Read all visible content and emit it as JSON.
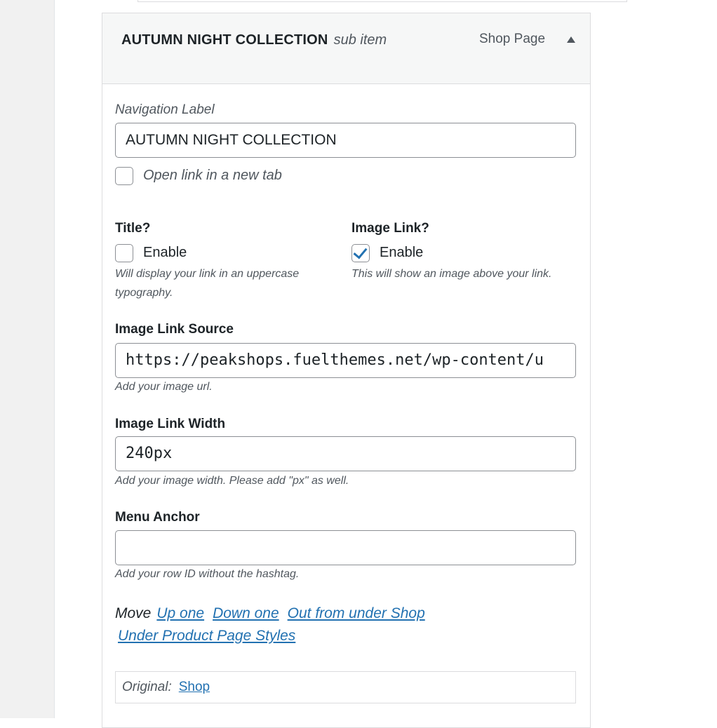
{
  "item": {
    "title": "AUTUMN NIGHT COLLECTION",
    "subtitle": "sub item",
    "type": "Shop Page"
  },
  "fields": {
    "nav_label": {
      "label": "Navigation Label",
      "value": "AUTUMN NIGHT COLLECTION"
    },
    "new_tab": {
      "label": "Open link in a new tab",
      "checked": false
    },
    "title": {
      "heading": "Title?",
      "checkbox_label": "Enable",
      "checked": false,
      "description": "Will display your link in an uppercase typography."
    },
    "image_link": {
      "heading": "Image Link?",
      "checkbox_label": "Enable",
      "checked": true,
      "description": "This will show an image above your link."
    },
    "image_source": {
      "label": "Image Link Source",
      "value": "https://peakshops.fuelthemes.net/wp-content/u",
      "description": "Add your image url."
    },
    "image_width": {
      "label": "Image Link Width",
      "value": "240px",
      "description": "Add your image width. Please add \"px\" as well."
    },
    "menu_anchor": {
      "label": "Menu Anchor",
      "value": "",
      "description": "Add your row ID without the hashtag."
    }
  },
  "move": {
    "label": "Move",
    "up": "Up one",
    "down": "Down one",
    "out": "Out from under Shop",
    "under": "Under Product Page Styles"
  },
  "original": {
    "label": "Original:",
    "link": "Shop"
  },
  "colors": {
    "link": "#2271b1",
    "border": "#dcdcde",
    "input_border": "#8c8f94",
    "header_bg": "#f6f7f7"
  },
  "icons": {
    "toggle": "triangle-up-icon",
    "checkmark": "check-icon"
  }
}
